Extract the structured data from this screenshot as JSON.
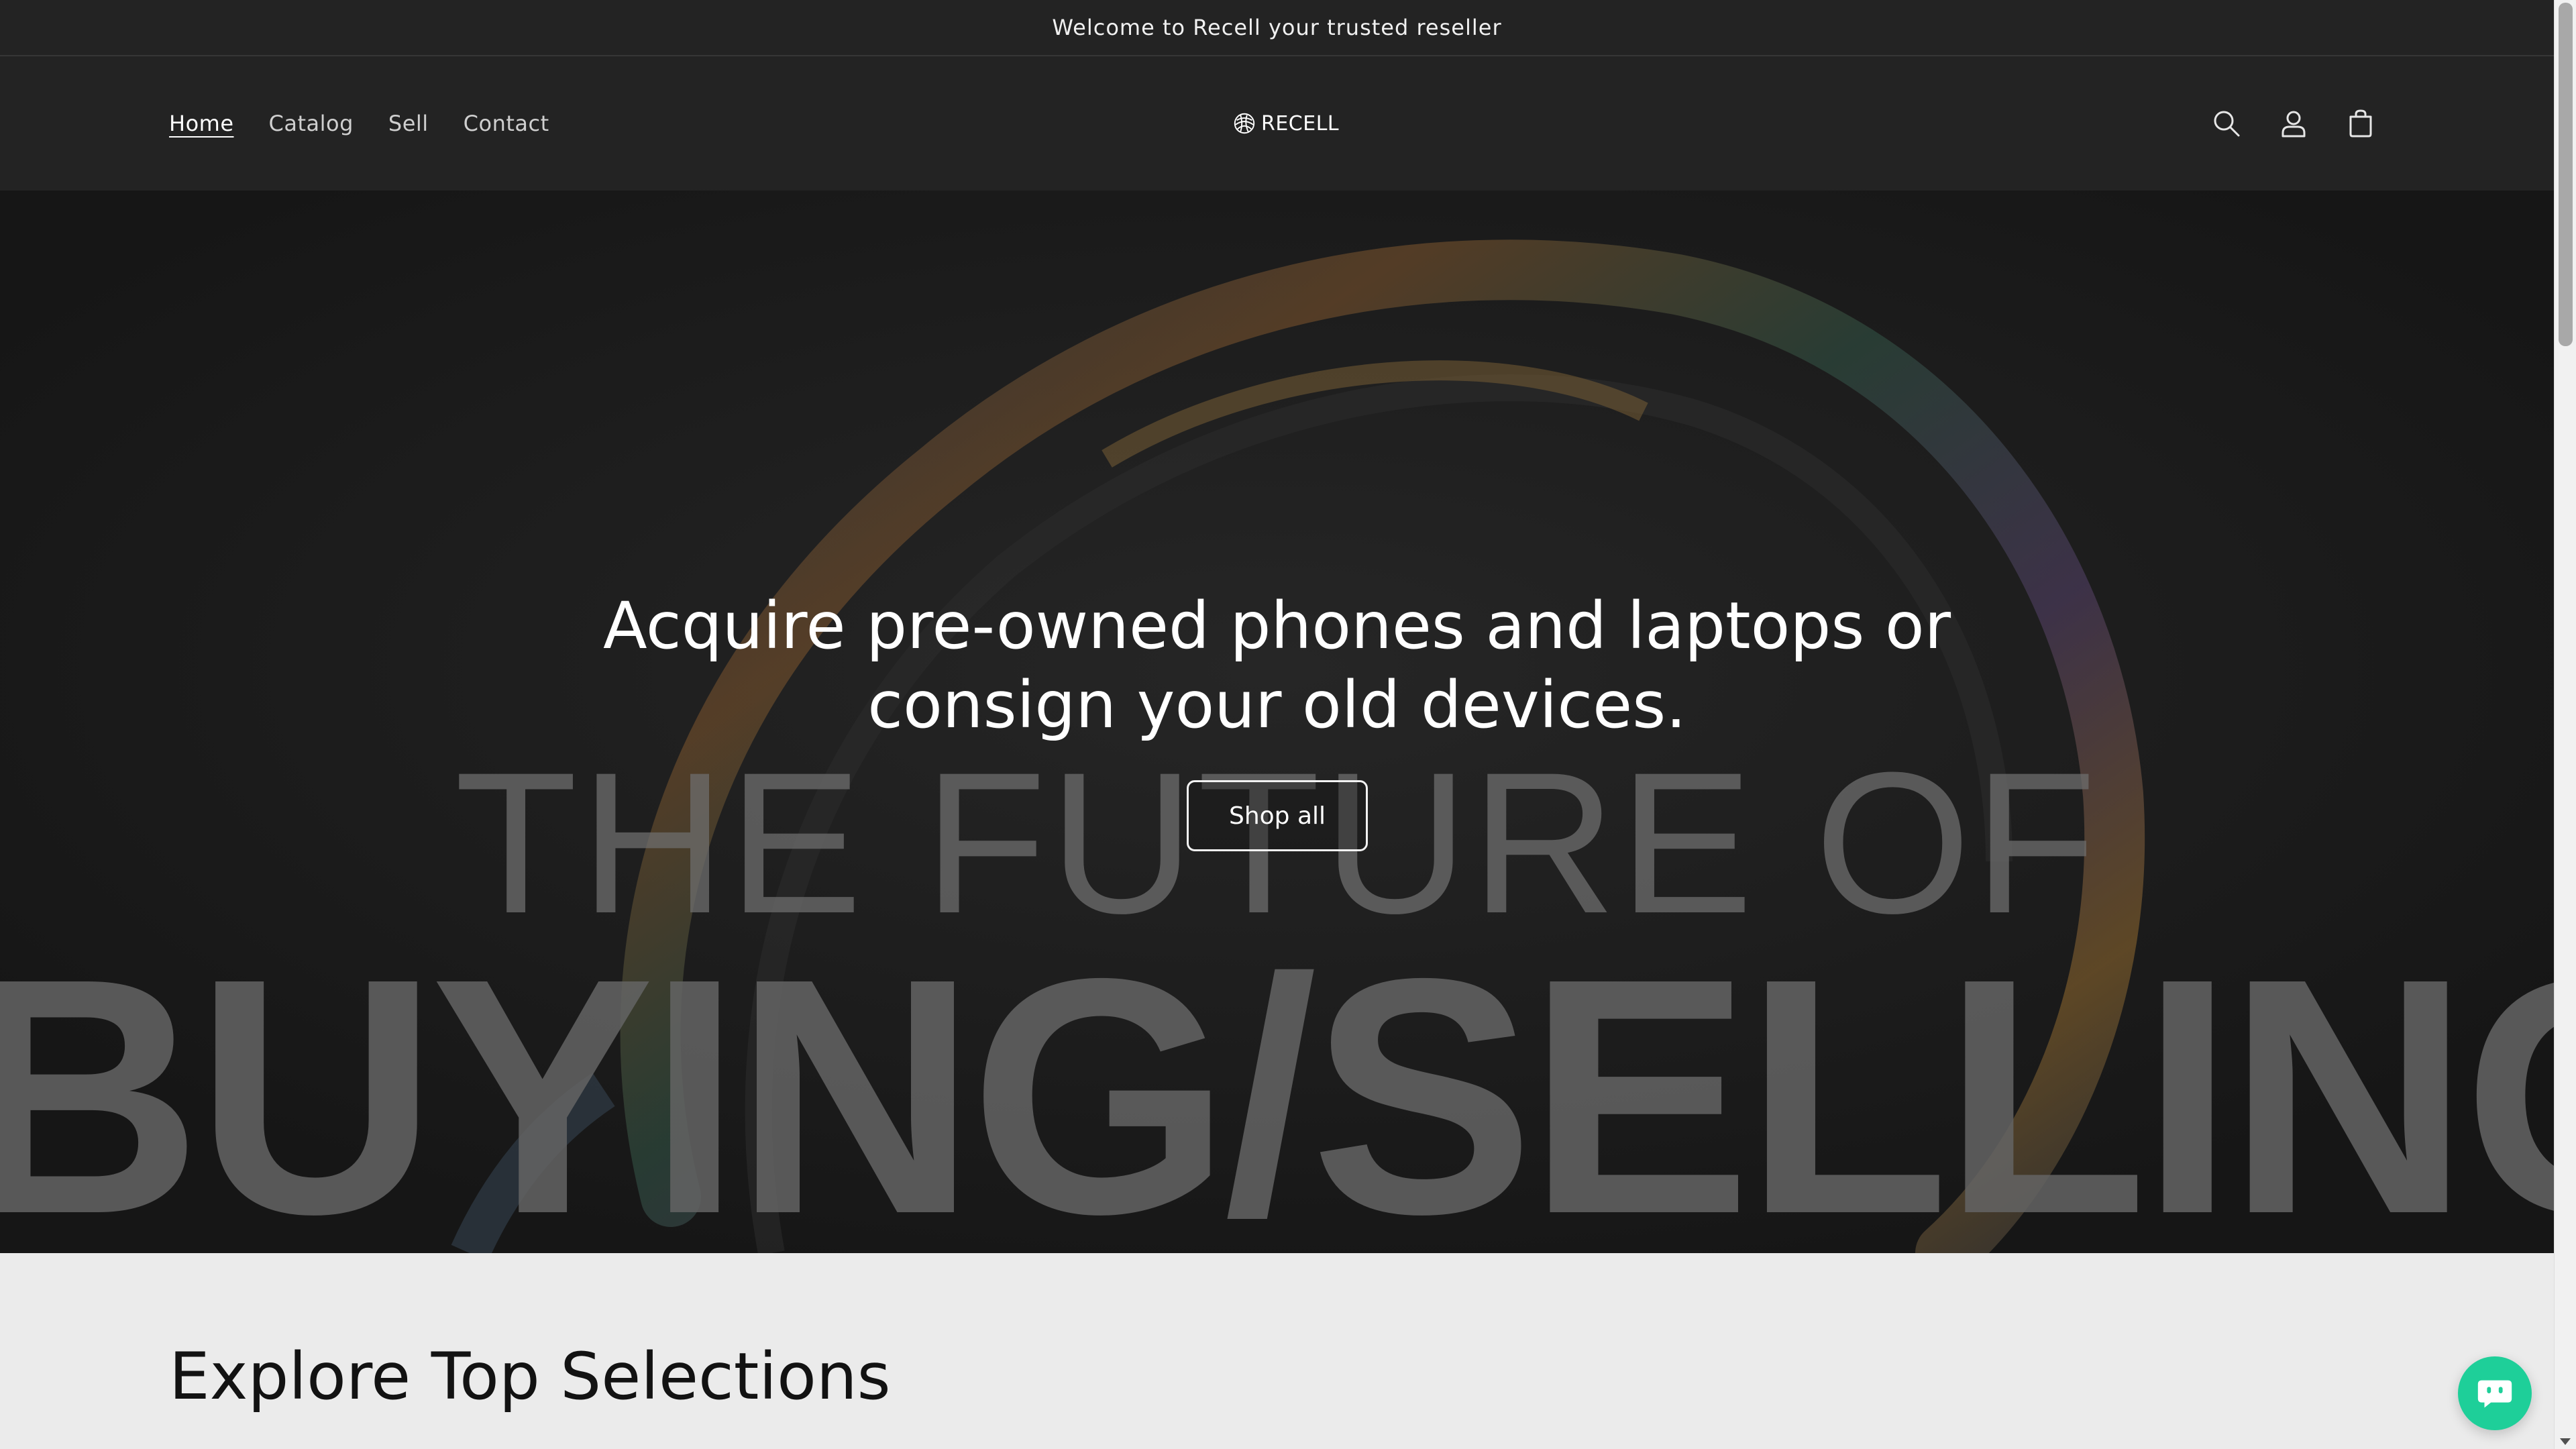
{
  "announcement": {
    "text": "Welcome to Recell your trusted reseller"
  },
  "header": {
    "nav": [
      {
        "label": "Home",
        "active": true
      },
      {
        "label": "Catalog",
        "active": false
      },
      {
        "label": "Sell",
        "active": false
      },
      {
        "label": "Contact",
        "active": false
      }
    ],
    "logo_text": "RECELL",
    "icons": [
      "search-icon",
      "account-icon",
      "cart-icon"
    ]
  },
  "hero": {
    "heading_line1": "Acquire pre-owned phones and laptops or",
    "heading_line2": "consign your old devices.",
    "button_label": "Shop all",
    "background_text_line1": "THE FUTURE OF",
    "background_text_line2": "BUYING/SELLING"
  },
  "explore": {
    "title": "Explore Top Selections"
  },
  "chat": {
    "icon": "chat-icon",
    "color": "#1ecf99"
  },
  "colors": {
    "header_bg": "#232323",
    "hero_bg": "#1a1a1a",
    "page_bg": "#ebebeb"
  }
}
